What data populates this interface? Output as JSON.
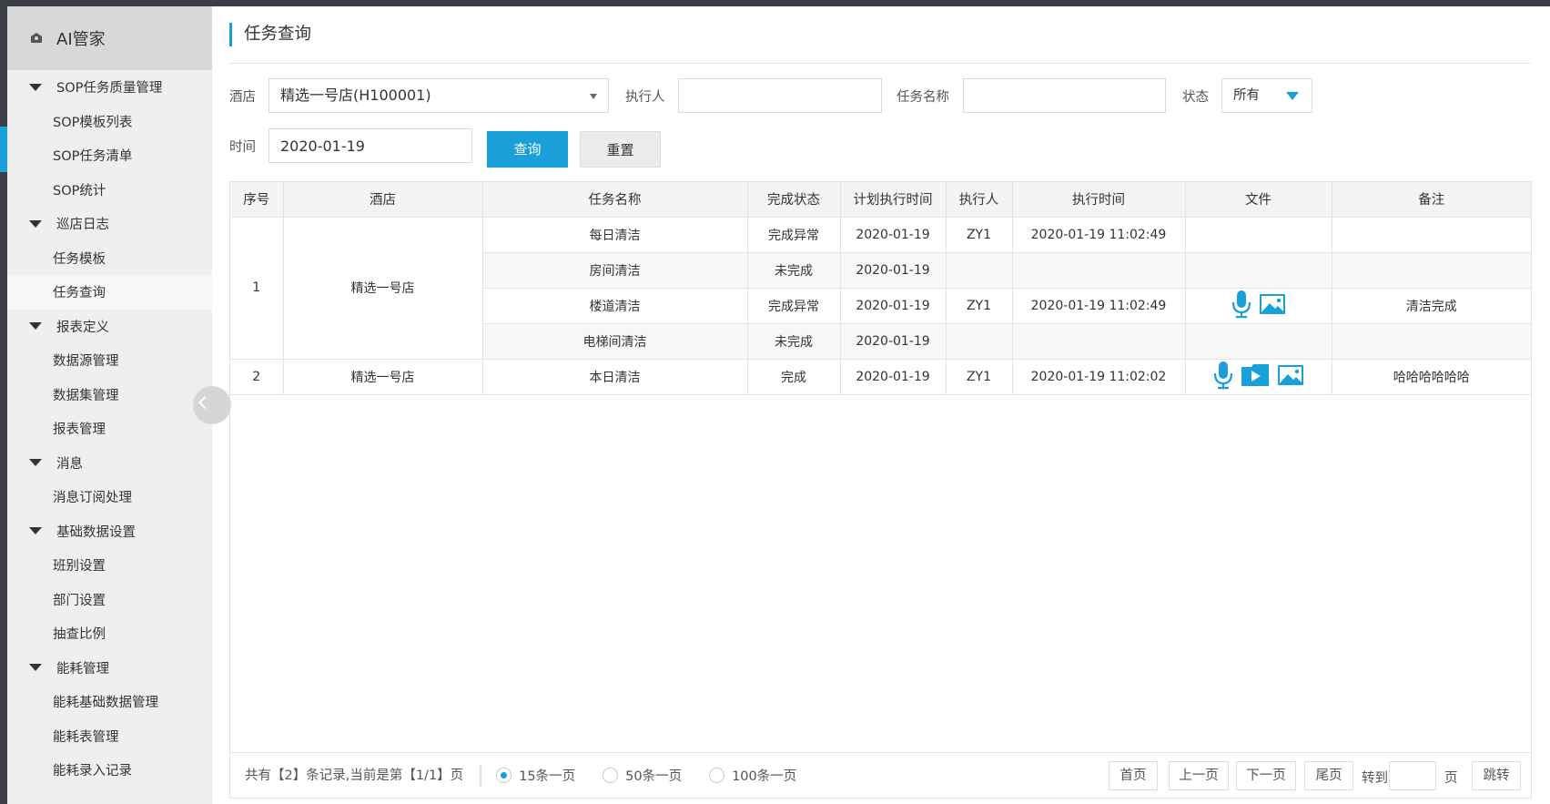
{
  "app": {
    "title": "AI管家"
  },
  "sidebar": {
    "items": [
      {
        "type": "group",
        "label": "SOP任务质量管理"
      },
      {
        "type": "sub",
        "label": "SOP模板列表"
      },
      {
        "type": "sub",
        "label": "SOP任务清单"
      },
      {
        "type": "sub",
        "label": "SOP统计"
      },
      {
        "type": "group",
        "label": "巡店日志"
      },
      {
        "type": "sub",
        "label": "任务模板"
      },
      {
        "type": "sub",
        "label": "任务查询",
        "active": true
      },
      {
        "type": "group",
        "label": "报表定义"
      },
      {
        "type": "sub",
        "label": "数据源管理"
      },
      {
        "type": "sub",
        "label": "数据集管理"
      },
      {
        "type": "sub",
        "label": "报表管理"
      },
      {
        "type": "group",
        "label": "消息"
      },
      {
        "type": "sub",
        "label": "消息订阅处理"
      },
      {
        "type": "group",
        "label": "基础数据设置"
      },
      {
        "type": "sub",
        "label": "班别设置"
      },
      {
        "type": "sub",
        "label": "部门设置"
      },
      {
        "type": "sub",
        "label": "抽查比例"
      },
      {
        "type": "group",
        "label": "能耗管理"
      },
      {
        "type": "sub",
        "label": "能耗基础数据管理"
      },
      {
        "type": "sub",
        "label": "能耗表管理"
      },
      {
        "type": "sub",
        "label": "能耗录入记录"
      }
    ]
  },
  "page": {
    "title": "任务查询"
  },
  "filters": {
    "hotel_label": "酒店",
    "hotel_value": "精选一号店(H100001)",
    "executor_label": "执行人",
    "executor_value": "",
    "task_name_label": "任务名称",
    "task_name_value": "",
    "status_label": "状态",
    "status_value": "所有",
    "time_label": "时间",
    "time_value": "2020-01-19",
    "query_button": "查询",
    "reset_button": "重置"
  },
  "table": {
    "columns": [
      "序号",
      "酒店",
      "任务名称",
      "完成状态",
      "计划执行时间",
      "执行人",
      "执行时间",
      "文件",
      "备注"
    ],
    "groups": [
      {
        "index": "1",
        "hotel": "精选一号店",
        "rows": [
          {
            "task": "每日清洁",
            "status": "完成异常",
            "plan_time": "2020-01-19",
            "executor": "ZY1",
            "exec_time": "2020-01-19 11:02:49",
            "files": [],
            "note": ""
          },
          {
            "task": "房间清洁",
            "status": "未完成",
            "plan_time": "2020-01-19",
            "executor": "",
            "exec_time": "",
            "files": [],
            "note": ""
          },
          {
            "task": "楼道清洁",
            "status": "完成异常",
            "plan_time": "2020-01-19",
            "executor": "ZY1",
            "exec_time": "2020-01-19 11:02:49",
            "files": [
              "microphone-icon",
              "image-icon"
            ],
            "note": "清洁完成"
          },
          {
            "task": "电梯间清洁",
            "status": "未完成",
            "plan_time": "2020-01-19",
            "executor": "",
            "exec_time": "",
            "files": [],
            "note": ""
          }
        ]
      },
      {
        "index": "2",
        "hotel": "精选一号店",
        "rows": [
          {
            "task": "本日清洁",
            "status": "完成",
            "plan_time": "2020-01-19",
            "executor": "ZY1",
            "exec_time": "2020-01-19 11:02:02",
            "files": [
              "microphone-icon",
              "video-icon",
              "image-icon"
            ],
            "note": "哈哈哈哈哈哈"
          }
        ]
      }
    ]
  },
  "footer": {
    "summary": "共有【2】条记录,当前是第【1/1】页",
    "page_sizes": [
      "15条一页",
      "50条一页",
      "100条一页"
    ],
    "selected_page_size": "15条一页",
    "first": "首页",
    "prev": "上一页",
    "next": "下一页",
    "last": "尾页",
    "goto_label": "转到",
    "goto_value": "",
    "page_unit": "页",
    "jump": "跳转"
  },
  "colors": {
    "accent": "#19a0d8",
    "sidebar_bg": "#efefef",
    "topbar": "#3b3f45"
  }
}
